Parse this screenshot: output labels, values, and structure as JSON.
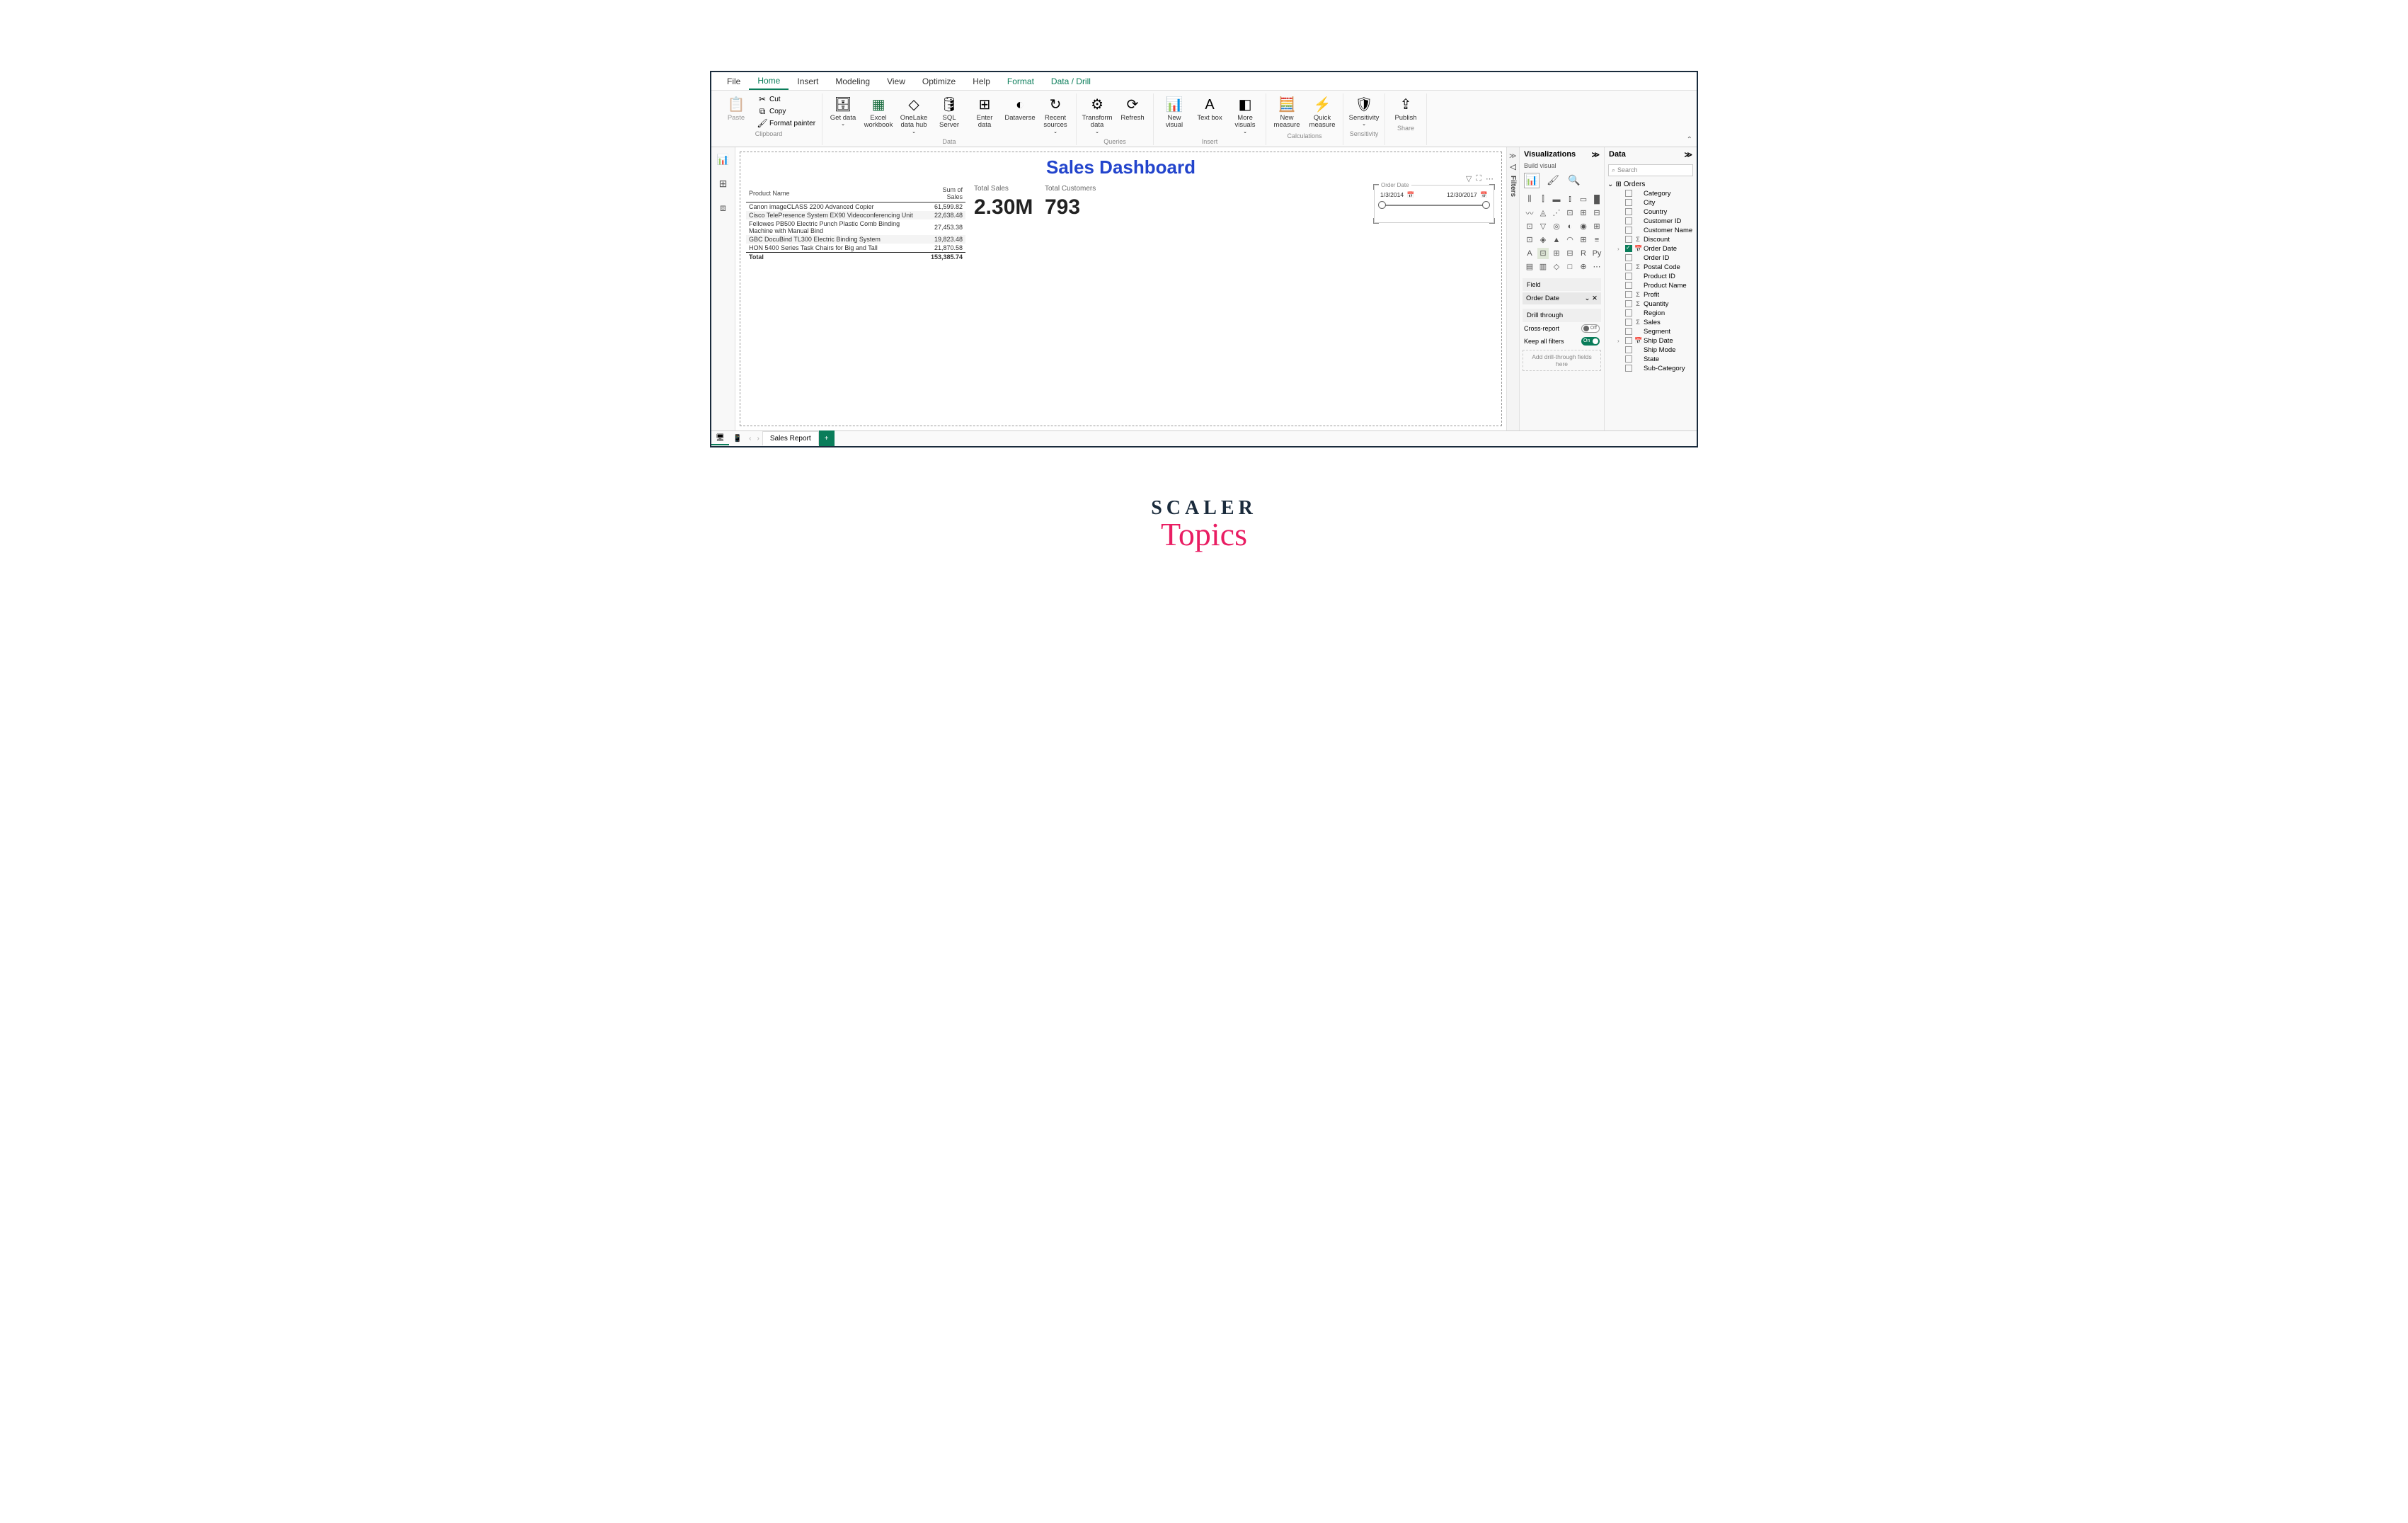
{
  "menu": {
    "file": "File",
    "home": "Home",
    "insert": "Insert",
    "modeling": "Modeling",
    "view": "View",
    "optimize": "Optimize",
    "help": "Help",
    "format": "Format",
    "datadrill": "Data / Drill"
  },
  "ribbon": {
    "clipboard": {
      "paste": "Paste",
      "cut": "Cut",
      "copy": "Copy",
      "format_painter": "Format painter",
      "label": "Clipboard"
    },
    "data_group": {
      "get_data": "Get data",
      "excel": "Excel workbook",
      "onelake": "OneLake data hub",
      "sql": "SQL Server",
      "enter": "Enter data",
      "dataverse": "Dataverse",
      "recent": "Recent sources",
      "label": "Data"
    },
    "queries": {
      "transform": "Transform data",
      "refresh": "Refresh",
      "label": "Queries"
    },
    "insert": {
      "new_visual": "New visual",
      "text_box": "Text box",
      "more_visuals": "More visuals",
      "label": "Insert"
    },
    "calculations": {
      "new_measure": "New measure",
      "quick_measure": "Quick measure",
      "label": "Calculations"
    },
    "sensitivity": {
      "sensitivity": "Sensitivity",
      "label": "Sensitivity"
    },
    "share": {
      "publish": "Publish",
      "label": "Share"
    }
  },
  "dashboard": {
    "title": "Sales Dashboard",
    "table": {
      "col1": "Product Name",
      "col2": "Sum of Sales",
      "rows": [
        {
          "name": "Canon imageCLASS 2200 Advanced Copier",
          "value": "61,599.82"
        },
        {
          "name": "Cisco TelePresence System EX90 Videoconferencing Unit",
          "value": "22,638.48"
        },
        {
          "name": "Fellowes PB500 Electric Punch Plastic Comb Binding Machine with Manual Bind",
          "value": "27,453.38"
        },
        {
          "name": "GBC DocuBind TL300 Electric Binding System",
          "value": "19,823.48"
        },
        {
          "name": "HON 5400 Series Task Chairs for Big and Tall",
          "value": "21,870.58"
        }
      ],
      "total_label": "Total",
      "total_value": "153,385.74"
    },
    "card_sales": {
      "label": "Total Sales",
      "value": "2.30M"
    },
    "card_customers": {
      "label": "Total Customers",
      "value": "793"
    },
    "slicer": {
      "field_label": "Order Date",
      "start": "1/3/2014",
      "end": "12/30/2017"
    }
  },
  "filters_label": "Filters",
  "viz_pane": {
    "title": "Visualizations",
    "subtitle": "Build visual",
    "field_label": "Field",
    "field_value": "Order Date",
    "drill_title": "Drill through",
    "cross_report": "Cross-report",
    "cross_report_state": "Off",
    "keep_filters": "Keep all filters",
    "keep_filters_state": "On",
    "drill_drop": "Add drill-through fields here"
  },
  "data_pane": {
    "title": "Data",
    "search_placeholder": "Search",
    "table_name": "Orders",
    "fields": [
      {
        "name": "Category",
        "checked": false,
        "icon": ""
      },
      {
        "name": "City",
        "checked": false,
        "icon": ""
      },
      {
        "name": "Country",
        "checked": false,
        "icon": ""
      },
      {
        "name": "Customer ID",
        "checked": false,
        "icon": ""
      },
      {
        "name": "Customer Name",
        "checked": false,
        "icon": ""
      },
      {
        "name": "Discount",
        "checked": false,
        "icon": "Σ"
      },
      {
        "name": "Order Date",
        "checked": true,
        "icon": "📅",
        "expand": true
      },
      {
        "name": "Order ID",
        "checked": false,
        "icon": ""
      },
      {
        "name": "Postal Code",
        "checked": false,
        "icon": "Σ"
      },
      {
        "name": "Product ID",
        "checked": false,
        "icon": ""
      },
      {
        "name": "Product Name",
        "checked": false,
        "icon": ""
      },
      {
        "name": "Profit",
        "checked": false,
        "icon": "Σ"
      },
      {
        "name": "Quantity",
        "checked": false,
        "icon": "Σ"
      },
      {
        "name": "Region",
        "checked": false,
        "icon": ""
      },
      {
        "name": "Sales",
        "checked": false,
        "icon": "Σ"
      },
      {
        "name": "Segment",
        "checked": false,
        "icon": ""
      },
      {
        "name": "Ship Date",
        "checked": false,
        "icon": "📅",
        "expand": true
      },
      {
        "name": "Ship Mode",
        "checked": false,
        "icon": ""
      },
      {
        "name": "State",
        "checked": false,
        "icon": ""
      },
      {
        "name": "Sub-Category",
        "checked": false,
        "icon": ""
      }
    ]
  },
  "statusbar": {
    "tab_name": "Sales Report"
  },
  "chart_data": {
    "type": "table",
    "title": "Sales Dashboard",
    "kpis": [
      {
        "label": "Total Sales",
        "value": 2300000,
        "display": "2.30M"
      },
      {
        "label": "Total Customers",
        "value": 793
      }
    ],
    "date_range": {
      "start": "2014-01-03",
      "end": "2017-12-30"
    },
    "categories": [
      "Canon imageCLASS 2200 Advanced Copier",
      "Cisco TelePresence System EX90 Videoconferencing Unit",
      "Fellowes PB500 Electric Punch Plastic Comb Binding Machine with Manual Bind",
      "GBC DocuBind TL300 Electric Binding System",
      "HON 5400 Series Task Chairs for Big and Tall"
    ],
    "values": [
      61599.82,
      22638.48,
      27453.38,
      19823.48,
      21870.58
    ],
    "total": 153385.74,
    "xlabel": "Product Name",
    "ylabel": "Sum of Sales"
  },
  "logo": {
    "line1": "SCALER",
    "line2": "Topics"
  }
}
